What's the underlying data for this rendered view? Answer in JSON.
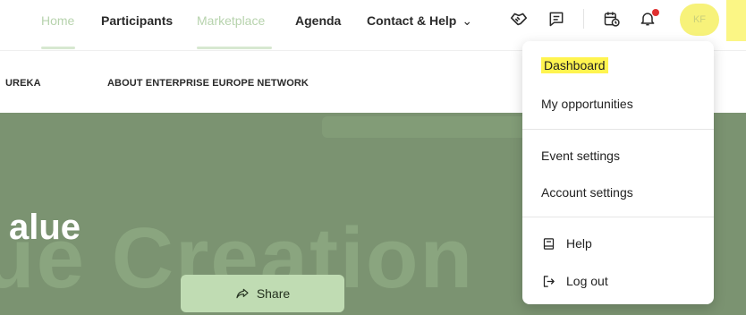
{
  "nav": {
    "items": [
      {
        "label": "Home",
        "state": "muted"
      },
      {
        "label": "Participants",
        "state": "normal"
      },
      {
        "label": "Marketplace",
        "state": "muted"
      },
      {
        "label": "Agenda",
        "state": "normal"
      },
      {
        "label": "Contact & Help",
        "state": "normal"
      }
    ],
    "contact_chevron": "⌄",
    "icons": [
      "handshake-icon",
      "chat-icon",
      "calendar-clock-icon",
      "bell-icon"
    ],
    "notification_dot_color": "#e03131",
    "avatar_initials": "KF",
    "avatar_highlight_color": "#f7f27a"
  },
  "subnav": {
    "items": [
      "UREKA",
      "ABOUT ENTERPRISE EUROPE NETWORK"
    ]
  },
  "hero": {
    "title_partial": "alue",
    "ghost_text": "ue Creation",
    "share_label": "Share",
    "background_color": "#7b9371"
  },
  "dropdown": {
    "items": [
      {
        "label": "Dashboard",
        "highlighted": true
      },
      {
        "label": "My opportunities"
      },
      {
        "label": "Event settings"
      },
      {
        "label": "Account settings"
      },
      {
        "label": "Help",
        "icon": "help-book-icon"
      },
      {
        "label": "Log out",
        "icon": "logout-icon"
      }
    ],
    "highlight_color": "#fff44f"
  }
}
